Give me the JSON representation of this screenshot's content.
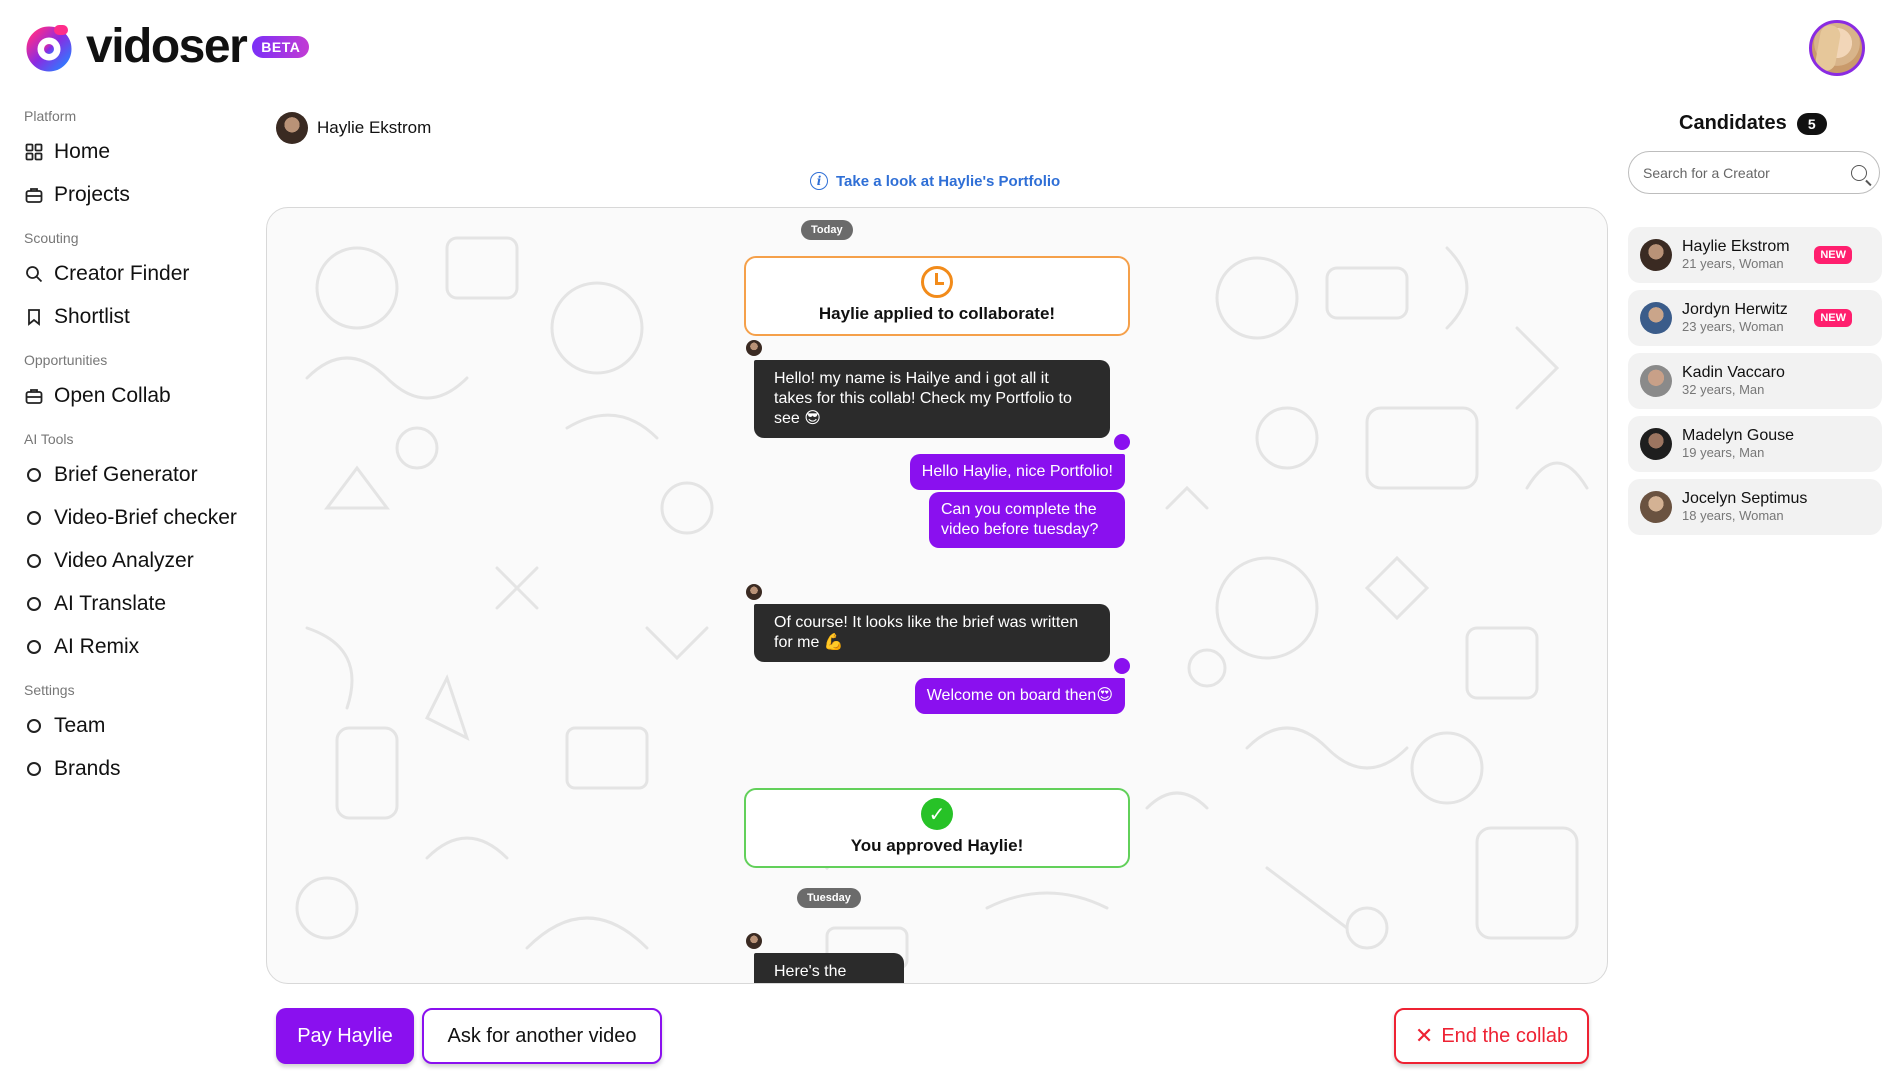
{
  "brand": {
    "name": "vidoser",
    "badge": "BETA",
    "accent": "#8a10ef"
  },
  "sidebar": {
    "sections": [
      {
        "label": "Platform",
        "items": [
          {
            "label": "Home",
            "icon": "grid-icon"
          },
          {
            "label": "Projects",
            "icon": "briefcase-icon"
          }
        ]
      },
      {
        "label": "Scouting",
        "items": [
          {
            "label": "Creator Finder",
            "icon": "search-icon"
          },
          {
            "label": "Shortlist",
            "icon": "bookmark-icon"
          }
        ]
      },
      {
        "label": "Opportunities",
        "items": [
          {
            "label": "Open Collab",
            "icon": "briefcase-icon"
          }
        ]
      },
      {
        "label": "AI Tools",
        "items": [
          {
            "label": "Brief Generator",
            "icon": "circle-icon"
          },
          {
            "label": "Video-Brief checker",
            "icon": "circle-icon"
          },
          {
            "label": "Video Analyzer",
            "icon": "circle-icon"
          },
          {
            "label": "AI Translate",
            "icon": "circle-icon"
          },
          {
            "label": "AI Remix",
            "icon": "circle-icon"
          }
        ]
      },
      {
        "label": "Settings",
        "items": [
          {
            "label": "Team",
            "icon": "circle-icon"
          },
          {
            "label": "Brands",
            "icon": "circle-icon"
          }
        ]
      }
    ]
  },
  "chat": {
    "person_name": "Haylie Ekstrom",
    "portfolio_link": "Take a look at Haylie's Portfolio",
    "date_today": "Today",
    "date_tuesday": "Tuesday",
    "applied_text": "Haylie applied to collaborate!",
    "approved_text": "You approved Haylie!",
    "messages": {
      "m1": "Hello! my name is Hailye and i got all it takes for this collab! Check my Portfolio to see 😎",
      "m2": "Hello Haylie, nice Portfolio!",
      "m3": "Can you complete the video before tuesday?",
      "m4": "Of course! It looks like the brief was written for me 💪",
      "m5": "Welcome on board then😍",
      "m6": "Here's the video!"
    }
  },
  "candidates": {
    "title": "Candidates",
    "count": "5",
    "search_placeholder": "Search for a Creator",
    "items": [
      {
        "name": "Haylie Ekstrom",
        "meta": "21 years, Woman",
        "badge": "NEW"
      },
      {
        "name": "Jordyn Herwitz",
        "meta": "23 years, Woman",
        "badge": "NEW"
      },
      {
        "name": "Kadin Vaccaro",
        "meta": "32 years, Man",
        "badge": ""
      },
      {
        "name": "Madelyn Gouse",
        "meta": "19 years, Man",
        "badge": ""
      },
      {
        "name": "Jocelyn Septimus",
        "meta": "18 years, Woman",
        "badge": ""
      }
    ]
  },
  "actions": {
    "pay": "Pay Haylie",
    "ask": "Ask for another video",
    "end": "End the collab"
  }
}
